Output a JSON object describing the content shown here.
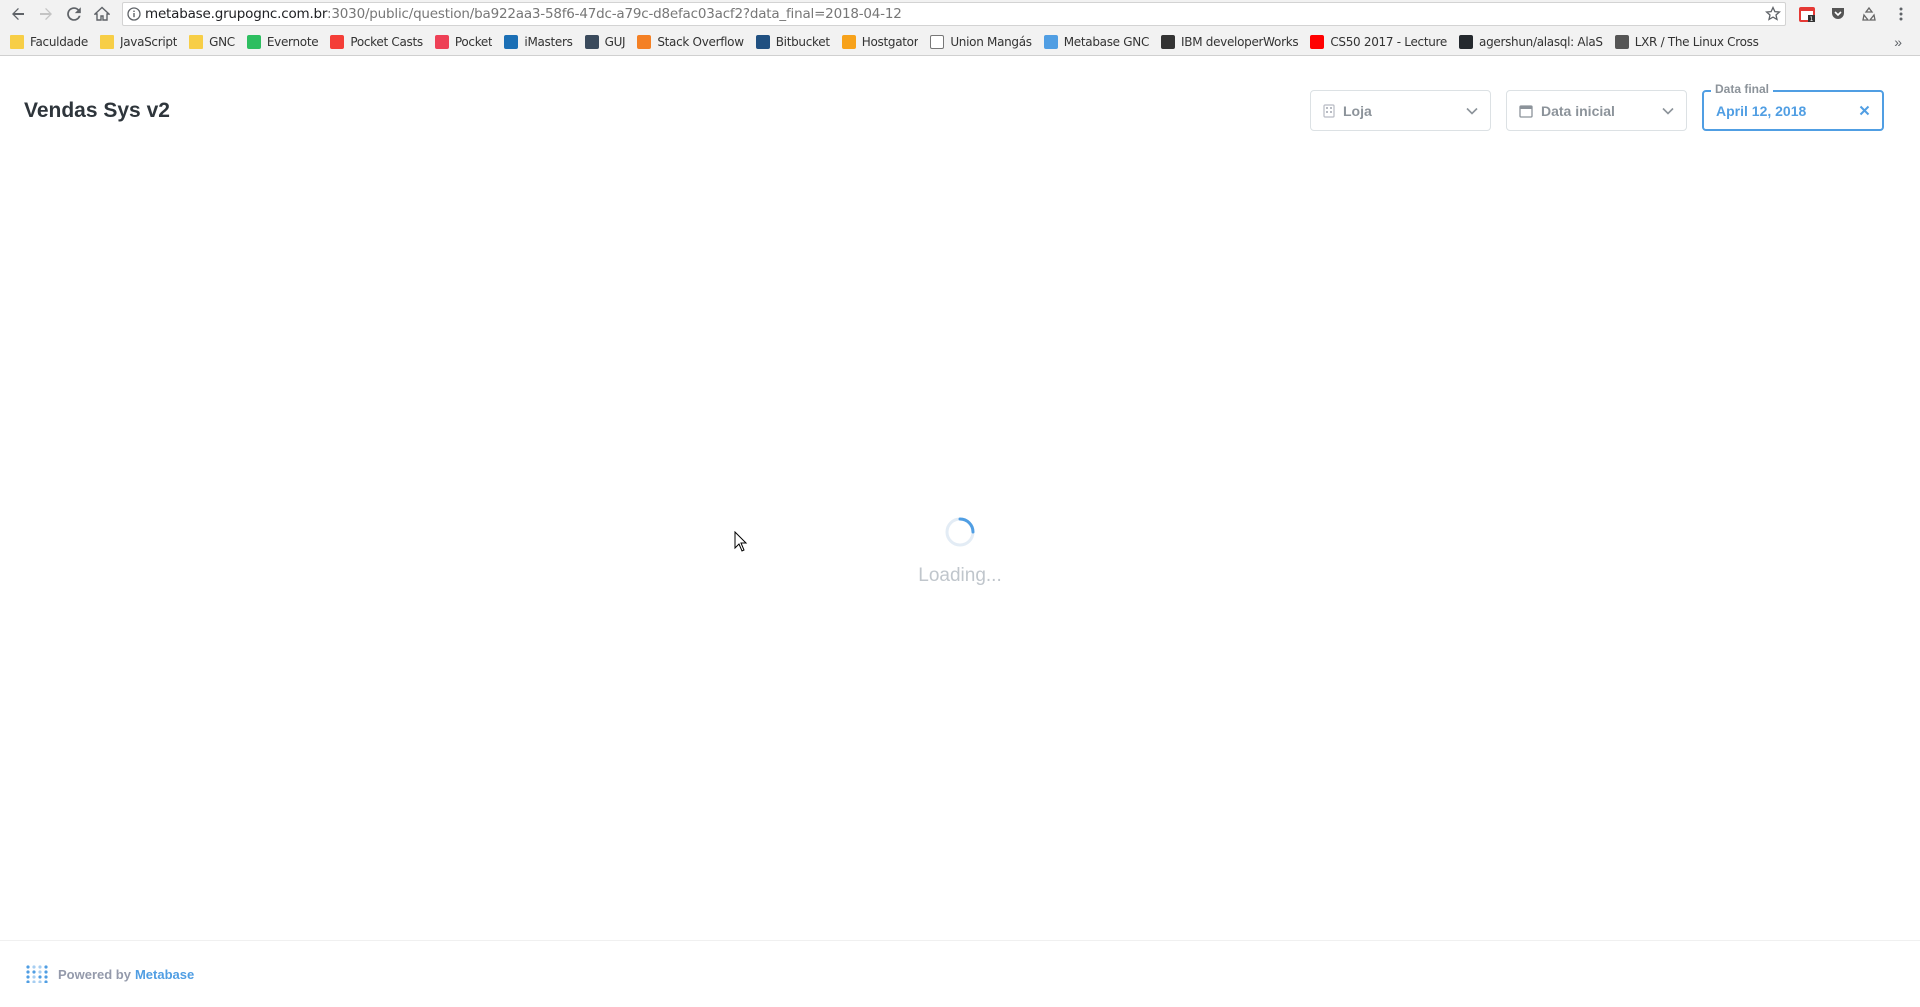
{
  "browser": {
    "url_host": "metabase.grupognc.com.br",
    "url_rest": ":3030/public/question/ba922aa3-58f6-47dc-a79c-d8efac03acf2?data_final=2018-04-12",
    "bookmarks": [
      {
        "label": "Faculdade",
        "icon": "folder-icon",
        "color": "#f7ce46"
      },
      {
        "label": "JavaScript",
        "icon": "folder-icon",
        "color": "#f7ce46"
      },
      {
        "label": "GNC",
        "icon": "folder-icon",
        "color": "#f7ce46"
      },
      {
        "label": "Evernote",
        "icon": "evernote-icon",
        "color": "#2dbe60"
      },
      {
        "label": "Pocket Casts",
        "icon": "pocket-casts-icon",
        "color": "#f43e37"
      },
      {
        "label": "Pocket",
        "icon": "pocket-icon",
        "color": "#ee4056"
      },
      {
        "label": "iMasters",
        "icon": "imasters-icon",
        "color": "#1b6fb5"
      },
      {
        "label": "GUJ",
        "icon": "guj-icon",
        "color": "#3a4a5c"
      },
      {
        "label": "Stack Overflow",
        "icon": "stack-overflow-icon",
        "color": "#f48024"
      },
      {
        "label": "Bitbucket",
        "icon": "bitbucket-icon",
        "color": "#205081"
      },
      {
        "label": "Hostgator",
        "icon": "hostgator-icon",
        "color": "#f7a21b"
      },
      {
        "label": "Union Mangás",
        "icon": "page-icon",
        "color": "#ffffff"
      },
      {
        "label": "Metabase GNC",
        "icon": "metabase-icon",
        "color": "#509ee3"
      },
      {
        "label": "IBM developerWorks",
        "icon": "ibm-icon",
        "color": "#333333"
      },
      {
        "label": "CS50 2017 - Lecture",
        "icon": "youtube-icon",
        "color": "#ff0000"
      },
      {
        "label": "agershun/alasql: AlaS",
        "icon": "github-icon",
        "color": "#24292e"
      },
      {
        "label": "LXR / The Linux Cross",
        "icon": "lxr-icon",
        "color": "#555555"
      }
    ]
  },
  "page": {
    "title": "Vendas Sys v2",
    "filters": {
      "loja_label": "Loja",
      "data_inicial_label": "Data inicial",
      "data_final_legend": "Data final",
      "data_final_value": "April 12, 2018"
    },
    "loading_text": "Loading...",
    "footer": {
      "powered_by": "Powered by",
      "brand": "Metabase"
    }
  },
  "colors": {
    "accent": "#509ee3",
    "text": "#2e353b",
    "muted": "#8c939a"
  }
}
